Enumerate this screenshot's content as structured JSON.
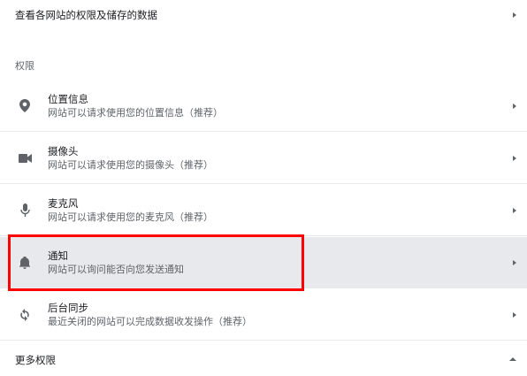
{
  "site_data_link": {
    "label": "查看各网站的权限及储存的数据",
    "icon": "chevron-right-icon"
  },
  "permissions_section": {
    "title": "权限",
    "items": [
      {
        "title": "位置信息",
        "subtitle": "网站可以请求使用您的位置信息（推荐）",
        "icon": "location-pin-icon"
      },
      {
        "title": "摄像头",
        "subtitle": "网站可以请求使用您的摄像头（推荐）",
        "icon": "camera-icon"
      },
      {
        "title": "麦克风",
        "subtitle": "网站可以请求使用您的麦克风（推荐）",
        "icon": "microphone-icon"
      },
      {
        "title": "通知",
        "subtitle": "网站可以询问能否向您发送通知",
        "icon": "bell-icon",
        "selected": true
      },
      {
        "title": "后台同步",
        "subtitle": "最近关闭的网站可以完成数据收发操作（推荐）",
        "icon": "sync-icon"
      }
    ]
  },
  "more_permissions": {
    "label": "更多权限",
    "icon": "chevron-up-icon"
  },
  "colors": {
    "highlight": "#ff0000",
    "selected_bg": "#e8e9ec",
    "icon": "#5f6368"
  }
}
